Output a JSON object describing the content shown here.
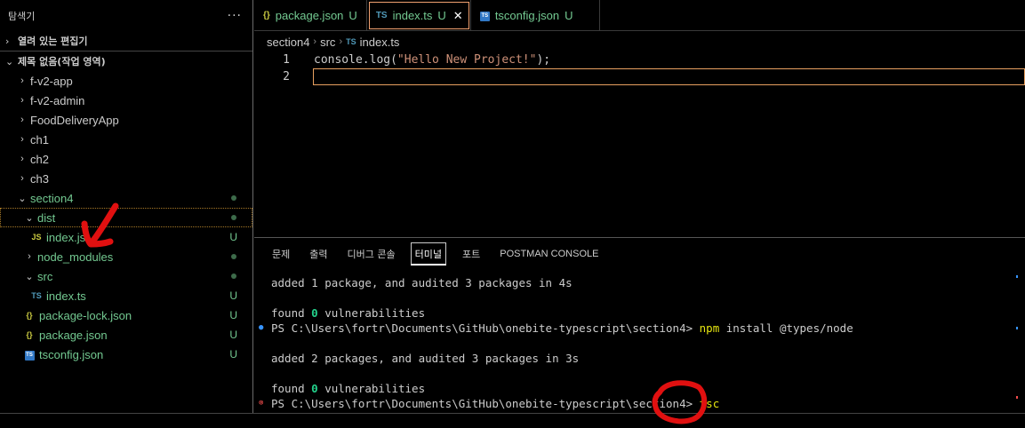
{
  "sidebar": {
    "title": "탐색기",
    "more": "···",
    "open_editors": "열려 있는 편집기",
    "workspace": "제목 없음(작업 영역)",
    "items": [
      {
        "label": "f-v2-app"
      },
      {
        "label": "f-v2-admin"
      },
      {
        "label": "FoodDeliveryApp"
      },
      {
        "label": "ch1"
      },
      {
        "label": "ch2"
      },
      {
        "label": "ch3"
      },
      {
        "label": "section4"
      },
      {
        "label": "dist"
      },
      {
        "label": "index.js",
        "icon": "JS",
        "status": "U"
      },
      {
        "label": "node_modules"
      },
      {
        "label": "src"
      },
      {
        "label": "index.ts",
        "icon": "TS",
        "status": "U"
      },
      {
        "label": "package-lock.json",
        "icon": "{}",
        "status": "U"
      },
      {
        "label": "package.json",
        "icon": "{}",
        "status": "U"
      },
      {
        "label": "tsconfig.json",
        "icon": "TS",
        "status": "U"
      }
    ]
  },
  "tabs": [
    {
      "label": "package.json",
      "icon": "{}",
      "status": "U"
    },
    {
      "label": "index.ts",
      "icon": "TS",
      "status": "U",
      "close": "✕"
    },
    {
      "label": "tsconfig.json",
      "icon": "TS",
      "status": "U"
    }
  ],
  "breadcrumb": [
    "section4",
    "src",
    "index.ts"
  ],
  "breadcrumb_icon": "TS",
  "editor": {
    "lines": [
      {
        "num": "1",
        "pre": "console.log(",
        "str": "\"Hello New Project!\"",
        "post": ");"
      },
      {
        "num": "2",
        "pre": "",
        "str": "",
        "post": ""
      }
    ]
  },
  "panel": {
    "tabs": [
      "문제",
      "출력",
      "디버그 콘솔",
      "터미널",
      "포트",
      "POSTMAN CONSOLE"
    ]
  },
  "terminal": {
    "l1": "added 1 package, and audited 3 packages in 4s",
    "l2_pre": "found ",
    "l2_zero": "0",
    "l2_post": " vulnerabilities",
    "l3_prompt": "PS C:\\Users\\fortr\\Documents\\GitHub\\onebite-typescript\\section4> ",
    "l3_cmd": "npm",
    "l3_args": " install @types/node",
    "l4": "added 2 packages, and audited 3 packages in 3s",
    "l5_pre": "found ",
    "l5_zero": "0",
    "l5_post": " vulnerabilities",
    "l6_prompt": "PS C:\\Users\\fortr\\Documents\\GitHub\\onebite-typescript\\section4> ",
    "l6_cmd": "tsc"
  },
  "colors": {
    "modified_green": "#73c991",
    "annotation_red": "#e01010",
    "ts_blue": "#519aba",
    "json_yellow": "#cbcb41"
  }
}
